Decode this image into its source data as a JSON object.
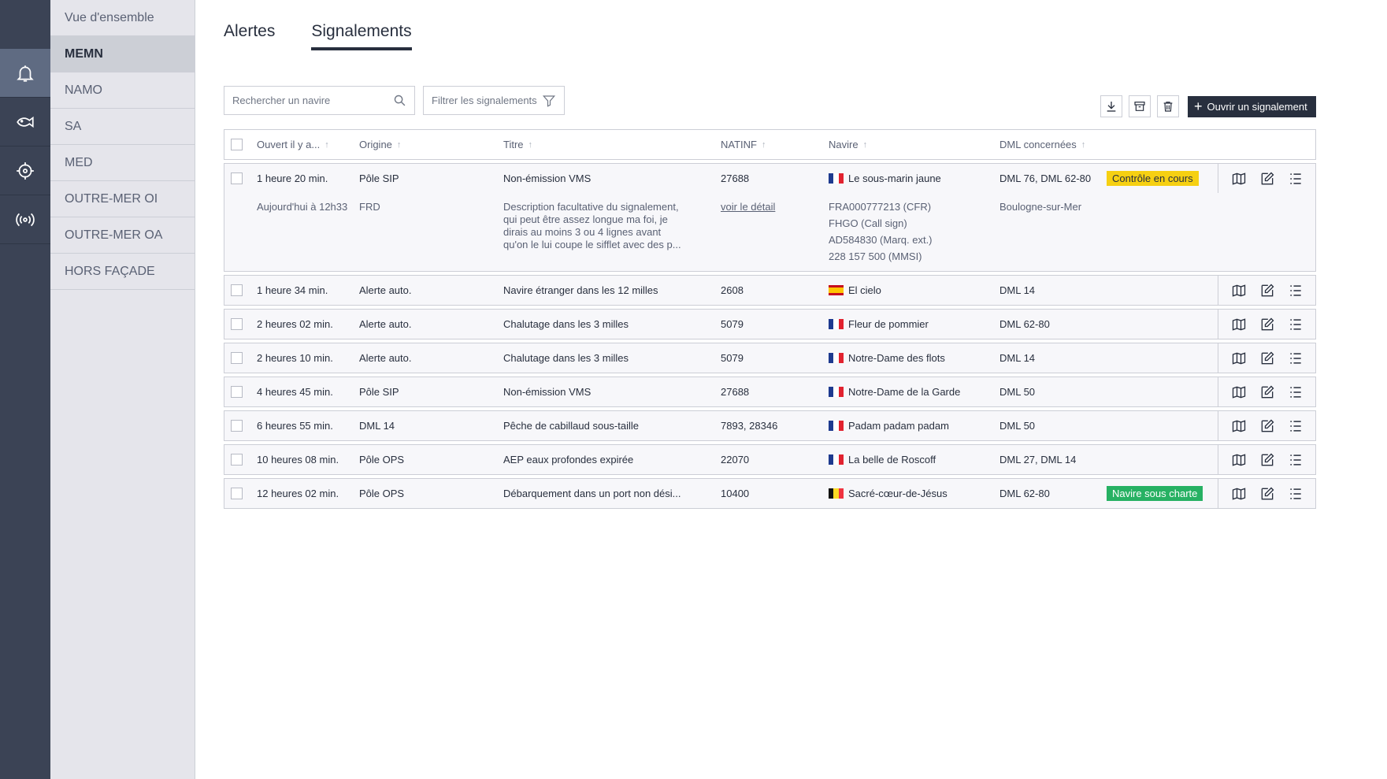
{
  "submenu": [
    {
      "label": "Vue d'ensemble",
      "active": false
    },
    {
      "label": "MEMN",
      "active": true
    },
    {
      "label": "NAMO",
      "active": false
    },
    {
      "label": "SA",
      "active": false
    },
    {
      "label": "MED",
      "active": false
    },
    {
      "label": "OUTRE-MER OI",
      "active": false
    },
    {
      "label": "OUTRE-MER OA",
      "active": false
    },
    {
      "label": "HORS FAÇADE",
      "active": false
    }
  ],
  "rail_icons": [
    "bell-icon",
    "fish-icon",
    "target-icon",
    "antenna-icon"
  ],
  "tabs": {
    "alerts": "Alertes",
    "reports": "Signalements"
  },
  "search": {
    "placeholder": "Rechercher un navire"
  },
  "filter": {
    "label": "Filtrer les signalements"
  },
  "open_report_label": "Ouvrir un signalement",
  "columns": {
    "opened": "Ouvert il y a...",
    "origin": "Origine",
    "title": "Titre",
    "natinf": "NATINF",
    "vessel": "Navire",
    "dml": "DML concernées"
  },
  "rows": [
    {
      "opened": "1 heure 20 min.",
      "origin": "Pôle SIP",
      "title": "Non-émission VMS",
      "natinf": "27688",
      "flag": "fr",
      "vessel": "Le sous-marin jaune",
      "dml": "DML 76, DML 62-80",
      "badge": "Contrôle en cours",
      "badge_color": "yellow"
    },
    {
      "opened": "1 heure 34 min.",
      "origin": "Alerte auto.",
      "title": "Navire étranger dans les 12 milles",
      "natinf": "2608",
      "flag": "es",
      "vessel": "El cielo",
      "dml": "DML 14",
      "badge": "",
      "badge_color": ""
    },
    {
      "opened": "2 heures 02 min.",
      "origin": "Alerte auto.",
      "title": "Chalutage dans les 3 milles",
      "natinf": "5079",
      "flag": "fr",
      "vessel": "Fleur de pommier",
      "dml": "DML 62-80",
      "badge": "",
      "badge_color": ""
    },
    {
      "opened": "2 heures 10 min.",
      "origin": "Alerte auto.",
      "title": "Chalutage dans les 3 milles",
      "natinf": "5079",
      "flag": "fr",
      "vessel": "Notre-Dame des flots",
      "dml": "DML 14",
      "badge": "",
      "badge_color": ""
    },
    {
      "opened": "4 heures 45 min.",
      "origin": "Pôle SIP",
      "title": "Non-émission VMS",
      "natinf": "27688",
      "flag": "fr",
      "vessel": "Notre-Dame de la Garde",
      "dml": "DML 50",
      "badge": "",
      "badge_color": ""
    },
    {
      "opened": "6 heures 55 min.",
      "origin": "DML 14",
      "title": "Pêche de cabillaud sous-taille",
      "natinf": "7893, 28346",
      "flag": "fr",
      "vessel": "Padam padam padam",
      "dml": "DML 50",
      "badge": "",
      "badge_color": ""
    },
    {
      "opened": "10 heures 08 min.",
      "origin": "Pôle OPS",
      "title": "AEP eaux profondes expirée",
      "natinf": "22070",
      "flag": "fr",
      "vessel": "La belle de Roscoff",
      "dml": "DML 27, DML 14",
      "badge": "",
      "badge_color": ""
    },
    {
      "opened": "12 heures 02 min.",
      "origin": "Pôle OPS",
      "title": "Débarquement dans un port non dési...",
      "natinf": "10400",
      "flag": "be",
      "vessel": "Sacré-cœur-de-Jésus",
      "dml": "DML 62-80",
      "badge": "Navire sous charte",
      "badge_color": "green"
    }
  ],
  "detail": {
    "date": "Aujourd'hui à 12h33",
    "origin": "FRD",
    "description": [
      "Description facultative du signalement,",
      "qui peut être assez longue ma foi, je",
      "dirais au moins 3 ou 4 lignes avant",
      "qu'on le lui coupe le sifflet avec des p..."
    ],
    "link": "voir le détail",
    "ids": [
      "FRA000777213 (CFR)",
      "FHGO (Call sign)",
      "AD584830 (Marq. ext.)",
      "228 157 500 (MMSI)"
    ],
    "port": "Boulogne-sur-Mer"
  }
}
